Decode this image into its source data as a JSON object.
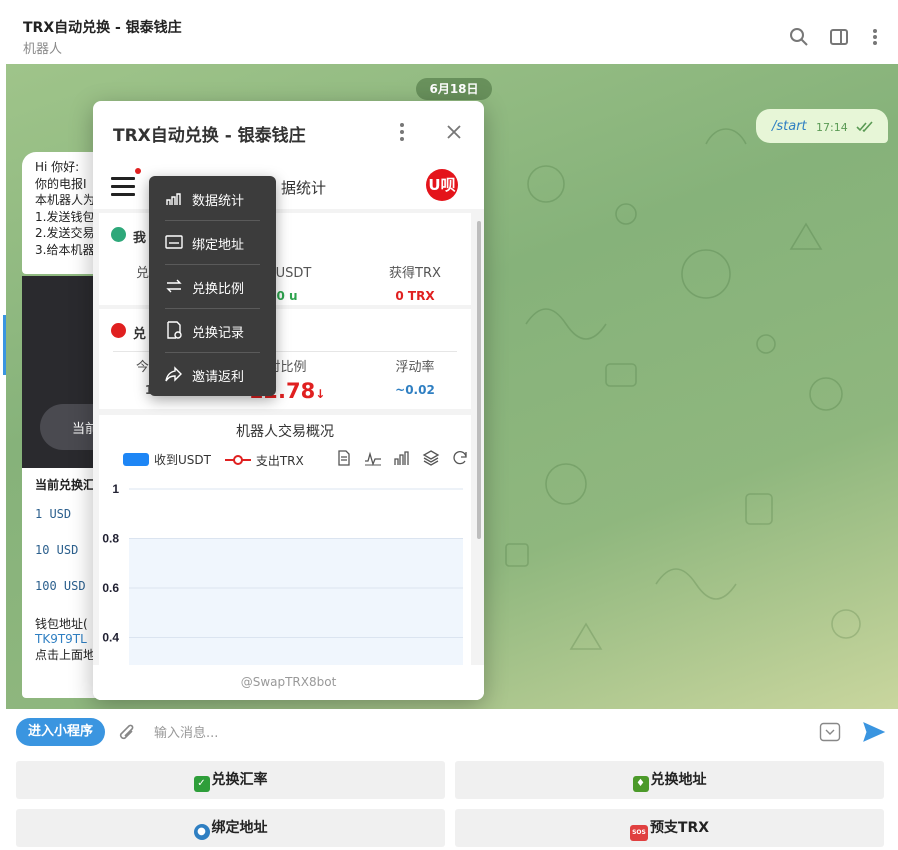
{
  "header": {
    "title": "TRX自动兑换 - 银泰钱庄",
    "subtitle": "机器人"
  },
  "chat": {
    "date_badge": "6月18日",
    "outgoing": {
      "text": "/start",
      "time": "17:14"
    },
    "incoming_lines": [
      "Hi 你好: ",
      "你的电报I",
      "本机器人为",
      "1.发送钱包",
      "2.发送交易",
      "3.给本机器"
    ],
    "dark_card_button": "当前",
    "incoming2": {
      "heading": "当前兑换汇",
      "rates": [
        "1   USD",
        "10  USD",
        "100 USD"
      ],
      "wallet_label": "钱包地址(",
      "wallet_address": "TK9T9TL",
      "click_hint": "点击上面地"
    }
  },
  "miniapp": {
    "title": "TRX自动兑换 - 银泰钱庄",
    "top_label": "据统计",
    "logo_text": "U呗",
    "card1": {
      "title": "我",
      "stats": [
        {
          "label": "兑换",
          "value": ""
        },
        {
          "label": "换USDT",
          "value": "0 u"
        },
        {
          "label": "获得TRX",
          "value": "0 TRX"
        }
      ]
    },
    "card2": {
      "title": "兑",
      "stats": [
        {
          "label": "今日",
          "value": "1"
        },
        {
          "label": "对比例",
          "value": "12.78",
          "arrow": "↓"
        },
        {
          "label": "浮动率",
          "value": "~0.02"
        }
      ]
    },
    "chart_title": "机器人交易概况",
    "footer": "@SwapTRX8bot"
  },
  "menu": {
    "items": [
      {
        "label": "数据统计",
        "icon": "bar-chart-icon"
      },
      {
        "label": "绑定地址",
        "icon": "card-icon"
      },
      {
        "label": "兑换比例",
        "icon": "swap-arrows-icon"
      },
      {
        "label": "兑换记录",
        "icon": "record-icon"
      },
      {
        "label": "邀请返利",
        "icon": "share-icon"
      }
    ]
  },
  "chart_data": {
    "type": "bar",
    "title": "机器人交易概况",
    "series": [
      {
        "name": "收到USDT",
        "color": "#1e86f5",
        "values": []
      },
      {
        "name": "支出TRX",
        "color": "#e02020",
        "values": []
      }
    ],
    "y_ticks": [
      "1",
      "0.8",
      "0.6",
      "0.4"
    ],
    "ylim": [
      0.4,
      1
    ],
    "xlabel": "",
    "ylabel": ""
  },
  "composer": {
    "mini_app_button": "进入小程序",
    "placeholder": "输入消息..."
  },
  "keyboard": {
    "buttons": [
      {
        "label": "兑换汇率",
        "emoji": "✓",
        "emoji_color": "#2e9e3a"
      },
      {
        "label": "兑换地址",
        "emoji": "♦",
        "emoji_color": "#4c9a2a"
      },
      {
        "label": "绑定地址",
        "emoji": "●",
        "emoji_color": "#2f7fc2"
      },
      {
        "label": "预支TRX",
        "emoji": "SOS",
        "emoji_color": "#e04040"
      }
    ]
  },
  "colors": {
    "accent": "#3a95e0",
    "positive": "#2ea44f",
    "negative": "#e02020",
    "menu_bg": "#3c3c3c"
  }
}
